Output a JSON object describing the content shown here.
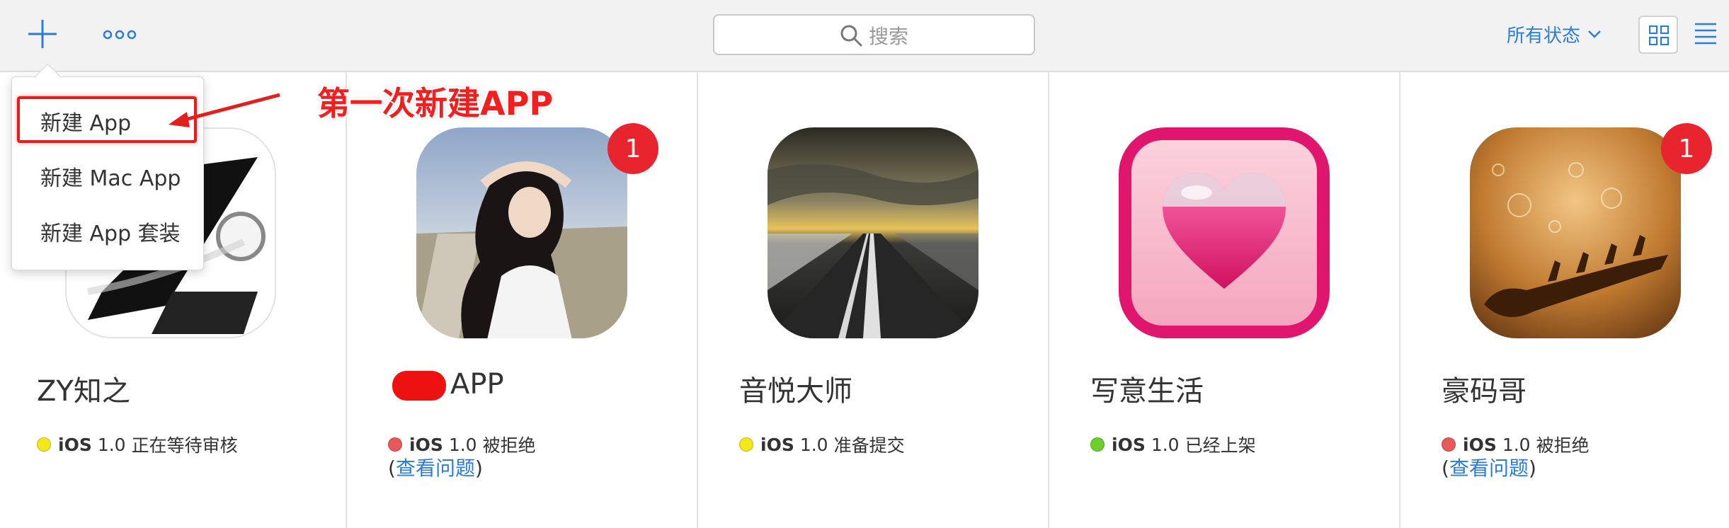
{
  "toolbar": {
    "add_icon": "plus-icon",
    "more_icon": "ellipsis-icon",
    "search_placeholder": "搜索",
    "status_filter_label": "所有状态",
    "grid_view_icon": "grid-view-icon",
    "list_view_icon": "list-view-icon"
  },
  "dropdown": {
    "items": [
      "新建 App",
      "新建 Mac App",
      "新建 App 套装"
    ]
  },
  "annotation": {
    "text": "第一次新建APP",
    "color": "#f02020"
  },
  "apps": [
    {
      "name": "ZY知之",
      "platform": "iOS",
      "version": "1.0",
      "status": "正在等待审核",
      "status_color": "#f2e81a",
      "badge": "",
      "issue_prefix": "",
      "issue_link": "",
      "issue_suffix": ""
    },
    {
      "name": "APP",
      "platform": "iOS",
      "version": "1.0",
      "status": "被拒绝",
      "status_color": "#e85a5a",
      "badge": "1",
      "issue_prefix": "(",
      "issue_link": "查看问题",
      "issue_suffix": ")"
    },
    {
      "name": "音悦大师",
      "platform": "iOS",
      "version": "1.0",
      "status": "准备提交",
      "status_color": "#f2e81a",
      "badge": "",
      "issue_prefix": "",
      "issue_link": "",
      "issue_suffix": ""
    },
    {
      "name": "写意生活",
      "platform": "iOS",
      "version": "1.0",
      "status": "已经上架",
      "status_color": "#6cd02a",
      "badge": "",
      "issue_prefix": "",
      "issue_link": "",
      "issue_suffix": ""
    },
    {
      "name": "豪码哥",
      "platform": "iOS",
      "version": "1.0",
      "status": "被拒绝",
      "status_color": "#e85a5a",
      "badge": "1",
      "issue_prefix": "(",
      "issue_link": "查看问题",
      "issue_suffix": ")"
    }
  ],
  "colors": {
    "accent": "#2a7cd8",
    "badge": "#e8252e"
  }
}
